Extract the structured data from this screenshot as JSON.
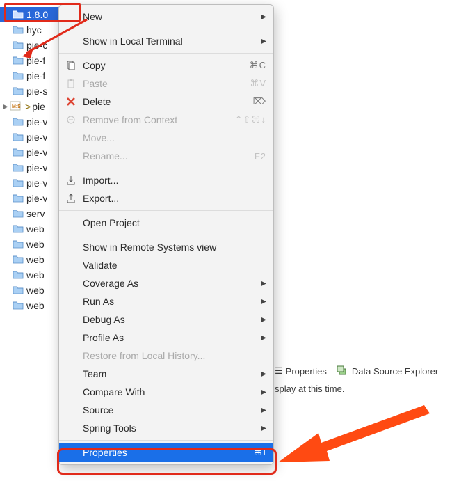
{
  "tree": {
    "items": [
      {
        "label": "1.8.0",
        "selected": true,
        "type": "folder"
      },
      {
        "label": "hyc",
        "type": "folder"
      },
      {
        "label": "pie-c",
        "type": "folder"
      },
      {
        "label": "pie-f",
        "type": "folder"
      },
      {
        "label": "pie-f",
        "type": "folder"
      },
      {
        "label": "pie-s",
        "type": "folder"
      },
      {
        "label": "pie",
        "type": "xsd",
        "expandable": true,
        "dirty": true
      },
      {
        "label": "pie-v",
        "type": "folder"
      },
      {
        "label": "pie-v",
        "type": "folder"
      },
      {
        "label": "pie-v",
        "type": "folder"
      },
      {
        "label": "pie-v",
        "type": "folder"
      },
      {
        "label": "pie-v",
        "type": "folder"
      },
      {
        "label": "pie-v",
        "type": "folder"
      },
      {
        "label": "serv",
        "type": "folder"
      },
      {
        "label": "web",
        "type": "folder"
      },
      {
        "label": "web",
        "type": "folder"
      },
      {
        "label": "web",
        "type": "folder"
      },
      {
        "label": "web",
        "type": "folder"
      },
      {
        "label": "web",
        "type": "folder"
      },
      {
        "label": "web",
        "type": "folder"
      }
    ]
  },
  "menu": {
    "groups": [
      [
        {
          "label": "New",
          "submenu": true
        }
      ],
      [
        {
          "label": "Show in Local Terminal",
          "submenu": true
        }
      ],
      [
        {
          "label": "Copy",
          "icon": "copy-icon",
          "shortcut": "⌘C"
        },
        {
          "label": "Paste",
          "icon": "paste-icon",
          "shortcut": "⌘V",
          "disabled": true
        },
        {
          "label": "Delete",
          "icon": "delete-icon",
          "shortcut": "⌦"
        },
        {
          "label": "Remove from Context",
          "icon": "remove-icon",
          "shortcut": "⌃⇧⌘↓",
          "disabled": true
        },
        {
          "label": "Move...",
          "disabled": true
        },
        {
          "label": "Rename...",
          "shortcut": "F2",
          "disabled": true
        }
      ],
      [
        {
          "label": "Import...",
          "icon": "import-icon"
        },
        {
          "label": "Export...",
          "icon": "export-icon"
        }
      ],
      [
        {
          "label": "Open Project"
        }
      ],
      [
        {
          "label": "Show in Remote Systems view"
        },
        {
          "label": "Validate"
        },
        {
          "label": "Coverage As",
          "submenu": true
        },
        {
          "label": "Run As",
          "submenu": true
        },
        {
          "label": "Debug As",
          "submenu": true
        },
        {
          "label": "Profile As",
          "submenu": true
        },
        {
          "label": "Restore from Local History...",
          "disabled": true
        },
        {
          "label": "Team",
          "submenu": true
        },
        {
          "label": "Compare With",
          "submenu": true
        },
        {
          "label": "Source",
          "submenu": true
        },
        {
          "label": "Spring Tools",
          "submenu": true
        }
      ],
      [
        {
          "label": "Properties",
          "shortcut": "⌘I",
          "highlight": true
        }
      ]
    ]
  },
  "bottom": {
    "tabs": [
      {
        "label": "Properties",
        "icon": "properties-icon"
      },
      {
        "label": "Data Source Explorer",
        "icon": "datasource-icon"
      }
    ],
    "message": "splay at this time."
  }
}
